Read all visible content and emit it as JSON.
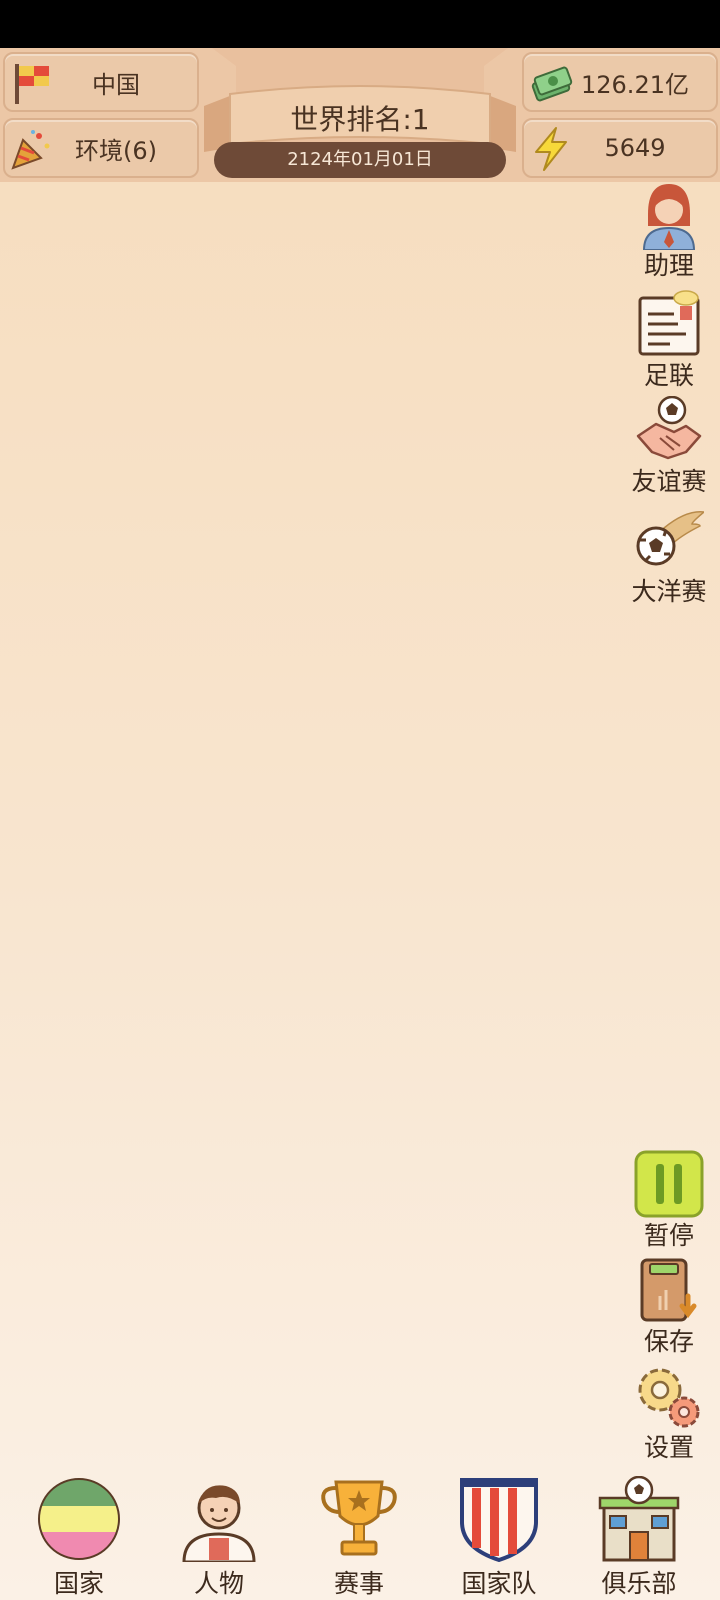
{
  "header": {
    "country": "中国",
    "environment": "环境(6)",
    "money": "126.21亿",
    "energy": "5649",
    "world_rank": "世界排名:1",
    "date": "2124年01月01日"
  },
  "side_menu": {
    "assistant": "助理",
    "football_association": "足联",
    "friendly_match": "友谊赛",
    "ocean_cup": "大洋赛",
    "pause": "暂停",
    "save": "保存",
    "settings": "设置"
  },
  "bottom_nav": {
    "country": "国家",
    "people": "人物",
    "events": "赛事",
    "national_team": "国家队",
    "club": "俱乐部"
  },
  "icons": {
    "country": "flag-icon",
    "environment": "party-popper-icon",
    "money": "cash-stack-icon",
    "energy": "lightning-icon",
    "assistant": "assistant-avatar-icon",
    "football_association": "document-certificate-icon",
    "friendly_match": "handshake-ball-icon",
    "ocean_cup": "flying-ball-icon",
    "pause": "pause-icon",
    "save": "save-folder-icon",
    "settings": "gears-icon"
  },
  "colors": {
    "accent_green": "#d2e64a",
    "pill_brown": "#6e4a37",
    "box_bg": "#ebc9a9"
  }
}
